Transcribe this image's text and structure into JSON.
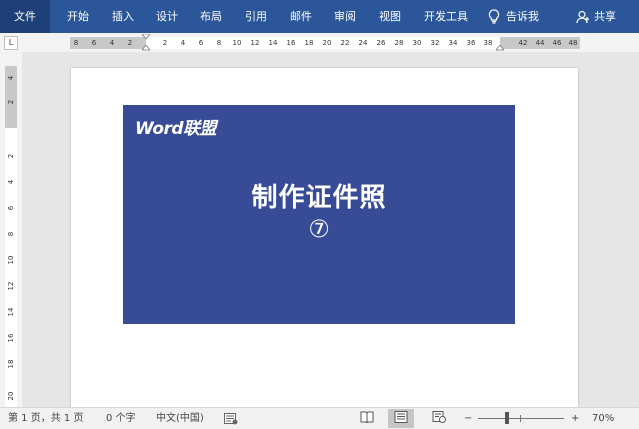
{
  "ribbon": {
    "tabs": [
      "文件",
      "开始",
      "插入",
      "设计",
      "布局",
      "引用",
      "邮件",
      "审阅",
      "视图",
      "开发工具"
    ],
    "tell_me": "告诉我",
    "share": "共享",
    "icons": {
      "tell_me": "lightbulb-icon",
      "share": "person-icon"
    },
    "colors": {
      "ribbon_bg": "#2b579a",
      "file_tab_bg": "#1e3f77"
    }
  },
  "ruler": {
    "tab_selector": "L",
    "horizontal_ticks": [
      "8",
      "6",
      "4",
      "2",
      "2",
      "4",
      "6",
      "8",
      "10",
      "12",
      "14",
      "16",
      "18",
      "20",
      "22",
      "24",
      "26",
      "28",
      "30",
      "32",
      "34",
      "36",
      "38",
      "42",
      "44",
      "46",
      "48"
    ],
    "vertical_ticks": [
      "4",
      "2",
      "2",
      "4",
      "6",
      "8",
      "10",
      "12",
      "14",
      "16",
      "18",
      "20"
    ]
  },
  "document": {
    "card": {
      "logo": "Word联盟",
      "title": "制作证件照",
      "number": "⑦",
      "background": "#374b97"
    }
  },
  "status_bar": {
    "page_info": "第 1 页，共 1 页",
    "word_count": "0 个字",
    "language": "中文(中国)",
    "zoom_minus": "−",
    "zoom_plus": "+",
    "zoom_level": "70%",
    "zoom_fraction": 0.7
  }
}
